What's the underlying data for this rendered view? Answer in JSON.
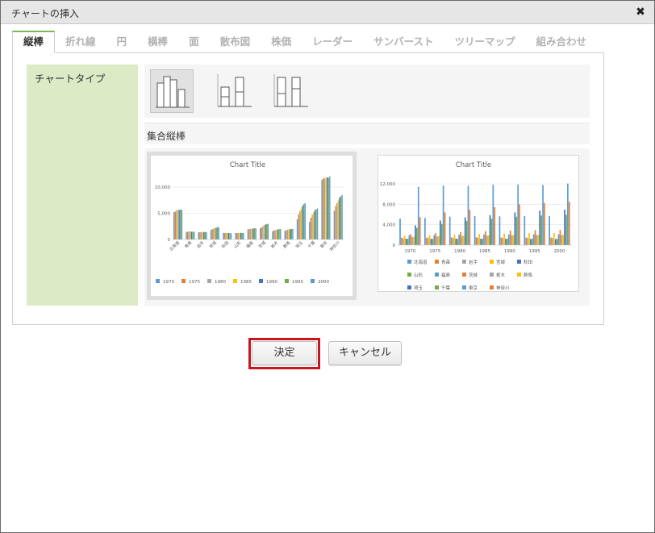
{
  "dialog": {
    "title": "チャートの挿入",
    "close_glyph": "✖"
  },
  "tabs": [
    {
      "label": "縦棒",
      "active": true
    },
    {
      "label": "折れ線"
    },
    {
      "label": "円"
    },
    {
      "label": "横棒"
    },
    {
      "label": "面"
    },
    {
      "label": "散布図"
    },
    {
      "label": "株価"
    },
    {
      "label": "レーダー"
    },
    {
      "label": "サンバースト"
    },
    {
      "label": "ツリーマップ"
    },
    {
      "label": "組み合わせ"
    }
  ],
  "sidebar": {
    "label": "チャートタイプ"
  },
  "chart_types": [
    {
      "icon": "clustered-column-icon",
      "selected": true
    },
    {
      "icon": "stacked-column-icon"
    },
    {
      "icon": "percent-stacked-column-icon"
    }
  ],
  "subtype": {
    "label": "集合縦棒"
  },
  "buttons": {
    "ok": "決定",
    "cancel": "キャンセル"
  },
  "colors": {
    "accent": "#7fb65b",
    "sidebar": "#dcebc6",
    "highlight": "#c8161d"
  },
  "chart_data": [
    {
      "type": "bar",
      "title": "Chart Title",
      "categories": [
        "北海道",
        "青森",
        "岩手",
        "宮城",
        "秋田",
        "山形",
        "福島",
        "茨城",
        "栃木",
        "群馬",
        "埼玉",
        "千葉",
        "東京",
        "神奈川"
      ],
      "ylim": [
        0,
        12000
      ],
      "yticks": [
        "0",
        "5,000",
        "10,000"
      ],
      "series": [
        {
          "name": "1970",
          "color": "#5b9bd5",
          "values": [
            5200,
            1450,
            1370,
            1820,
            1240,
            1230,
            1950,
            2140,
            1580,
            1650,
            3870,
            3370,
            11400,
            5470
          ]
        },
        {
          "name": "1975",
          "color": "#ed7d31",
          "values": [
            5340,
            1470,
            1390,
            1960,
            1230,
            1220,
            1970,
            2340,
            1700,
            1760,
            4820,
            4150,
            11670,
            6400
          ]
        },
        {
          "name": "1980",
          "color": "#a5a5a5",
          "values": [
            5580,
            1520,
            1420,
            2080,
            1260,
            1250,
            2040,
            2560,
            1790,
            1850,
            5420,
            4740,
            11620,
            6920
          ]
        },
        {
          "name": "1985",
          "color": "#ffc000",
          "values": [
            5680,
            1520,
            1430,
            2180,
            1250,
            1260,
            2080,
            2730,
            1870,
            1920,
            5860,
            5150,
            11830,
            7430
          ]
        },
        {
          "name": "1990",
          "color": "#4472c4",
          "values": [
            5640,
            1480,
            1420,
            2250,
            1230,
            1260,
            2100,
            2850,
            1940,
            1970,
            6410,
            5560,
            11860,
            7980
          ]
        },
        {
          "name": "1995",
          "color": "#70ad47",
          "values": [
            5690,
            1480,
            1420,
            2330,
            1210,
            1260,
            2130,
            2960,
            1980,
            2000,
            6760,
            5800,
            11770,
            8250
          ]
        },
        {
          "name": "2000",
          "color": "#5b9bd5",
          "values": [
            5680,
            1480,
            1420,
            2370,
            1190,
            1240,
            2130,
            2990,
            2000,
            2020,
            6940,
            5930,
            12060,
            8490
          ]
        }
      ]
    },
    {
      "type": "bar",
      "title": "Chart Title",
      "categories": [
        "1970",
        "1975",
        "1980",
        "1985",
        "1990",
        "1995",
        "2000"
      ],
      "ylim": [
        0,
        12000
      ],
      "yticks": [
        "0",
        "4,000",
        "8,000",
        "12,000"
      ],
      "xticks": [
        "1970",
        "1975",
        "1980",
        "1985",
        "1990",
        "1995",
        "2000"
      ],
      "legend": [
        {
          "name": "北海道",
          "color": "#5b9bd5"
        },
        {
          "name": "青森",
          "color": "#ed7d31"
        },
        {
          "name": "岩手",
          "color": "#a5a5a5"
        },
        {
          "name": "宮城",
          "color": "#ffc000"
        },
        {
          "name": "秋田",
          "color": "#4472c4"
        },
        {
          "name": "山形",
          "color": "#70ad47"
        },
        {
          "name": "福島",
          "color": "#5b9bd5"
        },
        {
          "name": "茨城",
          "color": "#ed7d31"
        },
        {
          "name": "栃木",
          "color": "#a5a5a5"
        },
        {
          "name": "群馬",
          "color": "#ffc000"
        },
        {
          "name": "埼玉",
          "color": "#4472c4"
        },
        {
          "name": "千葉",
          "color": "#70ad47"
        },
        {
          "name": "東京",
          "color": "#5b9bd5"
        },
        {
          "name": "神奈川",
          "color": "#ed7d31"
        }
      ]
    }
  ]
}
